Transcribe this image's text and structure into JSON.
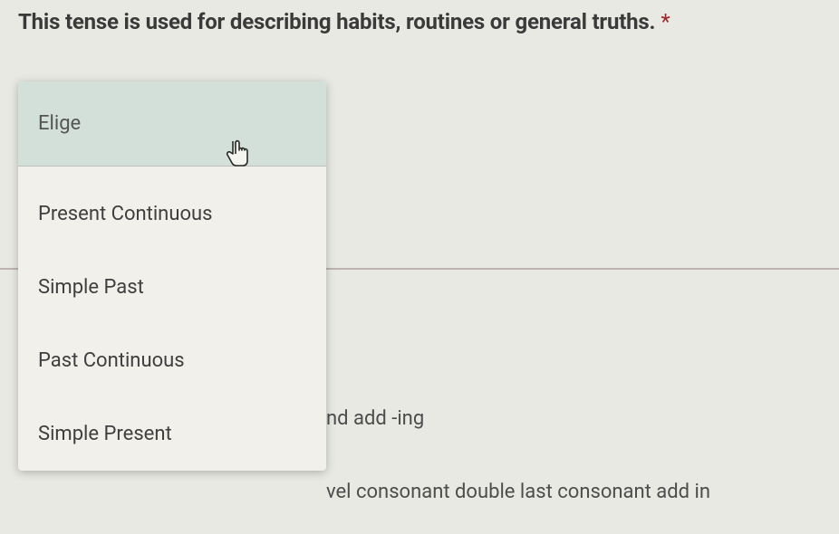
{
  "question": {
    "text": "This tense is used for describing habits, routines or general truths.",
    "required_marker": "*"
  },
  "dropdown": {
    "placeholder": "Elige",
    "options": [
      "Present Continuous",
      "Simple Past",
      "Past Continuous",
      "Simple Present"
    ]
  },
  "background": {
    "line1": "nd add -ing",
    "line2": "vel consonant double last consonant add in"
  }
}
